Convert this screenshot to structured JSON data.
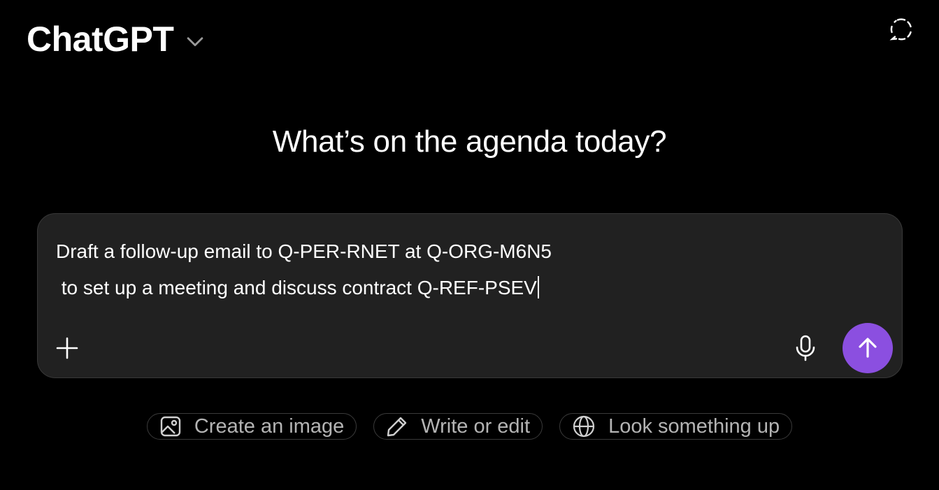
{
  "header": {
    "title": "ChatGPT"
  },
  "main": {
    "heading": "What’s on the agenda today?"
  },
  "composer": {
    "line1": "Draft a follow-up email to Q-PER-RNET at Q-ORG-M6N5",
    "line2": " to set up a meeting and discuss contract Q-REF-PSEV",
    "send_color": "#8b4fe0"
  },
  "suggestions": [
    {
      "label": "Create an image",
      "icon": "image-icon"
    },
    {
      "label": "Write or edit",
      "icon": "pencil-icon"
    },
    {
      "label": "Look something up",
      "icon": "globe-icon"
    }
  ],
  "colors": {
    "background": "#000000",
    "composer_bg": "#212121",
    "accent": "#8b4fe0"
  }
}
